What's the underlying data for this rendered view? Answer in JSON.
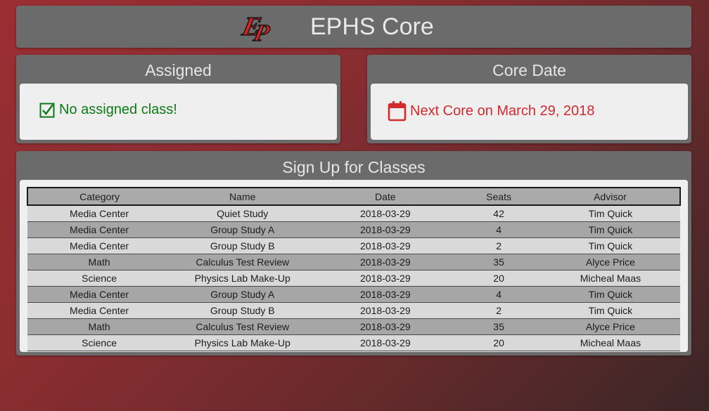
{
  "header": {
    "title": "EPHS Core",
    "logo_text": "EP",
    "logo_color": "#e02020"
  },
  "assigned": {
    "title": "Assigned",
    "status_icon": "checkbox-icon",
    "status": "No assigned class!",
    "color": "#0e7a17"
  },
  "core_date": {
    "title": "Core Date",
    "icon": "calendar-icon",
    "text": "Next Core on March 29, 2018",
    "color": "#d12a2f"
  },
  "signup": {
    "title": "Sign Up for Classes",
    "columns": [
      "Category",
      "Name",
      "Date",
      "Seats",
      "Advisor"
    ],
    "rows": [
      [
        "Media Center",
        "Quiet Study",
        "2018-03-29",
        "42",
        "Tim Quick"
      ],
      [
        "Media Center",
        "Group Study A",
        "2018-03-29",
        "4",
        "Tim Quick"
      ],
      [
        "Media Center",
        "Group Study B",
        "2018-03-29",
        "2",
        "Tim Quick"
      ],
      [
        "Math",
        "Calculus Test Review",
        "2018-03-29",
        "35",
        "Alyce Price"
      ],
      [
        "Science",
        "Physics Lab Make-Up",
        "2018-03-29",
        "20",
        "Micheal Maas"
      ],
      [
        "Media Center",
        "Group Study A",
        "2018-03-29",
        "4",
        "Tim Quick"
      ],
      [
        "Media Center",
        "Group Study B",
        "2018-03-29",
        "2",
        "Tim Quick"
      ],
      [
        "Math",
        "Calculus Test Review",
        "2018-03-29",
        "35",
        "Alyce Price"
      ],
      [
        "Science",
        "Physics Lab Make-Up",
        "2018-03-29",
        "20",
        "Micheal Maas"
      ]
    ]
  }
}
